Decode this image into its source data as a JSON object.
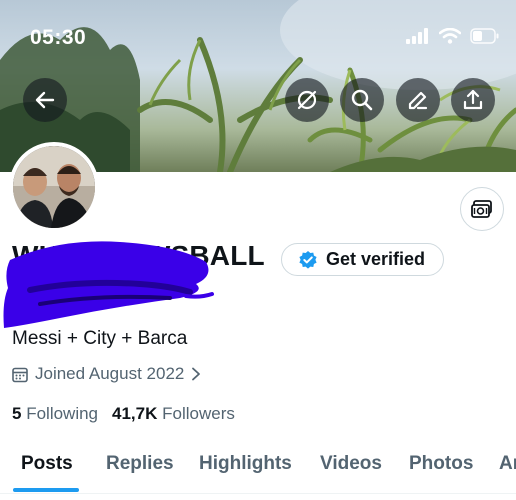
{
  "status_bar": {
    "time": "05:30"
  },
  "profile": {
    "display_name": "WHOKNOWSBALL",
    "verify_label": "Get verified",
    "bio": "Messi + City + Barca",
    "joined": "Joined August 2022",
    "following_count": "5",
    "following_label": "Following",
    "followers_count": "41,7K",
    "followers_label": "Followers"
  },
  "tabs": [
    {
      "label": "Posts"
    },
    {
      "label": "Replies"
    },
    {
      "label": "Highlights"
    },
    {
      "label": "Videos"
    },
    {
      "label": "Photos"
    },
    {
      "label": "Ar"
    }
  ],
  "colors": {
    "accent": "#1d9bf0",
    "redaction": "#3a00e8",
    "text_primary": "#0f1419",
    "text_secondary": "#536471"
  },
  "icons": {
    "back": "arrow-left-icon",
    "mute": "mute-icon",
    "search": "search-icon",
    "edit": "edit-icon",
    "share": "share-icon",
    "wallet": "wallet-icon",
    "calendar": "calendar-icon",
    "chevron": "chevron-right-icon",
    "verified": "verified-badge-icon"
  }
}
